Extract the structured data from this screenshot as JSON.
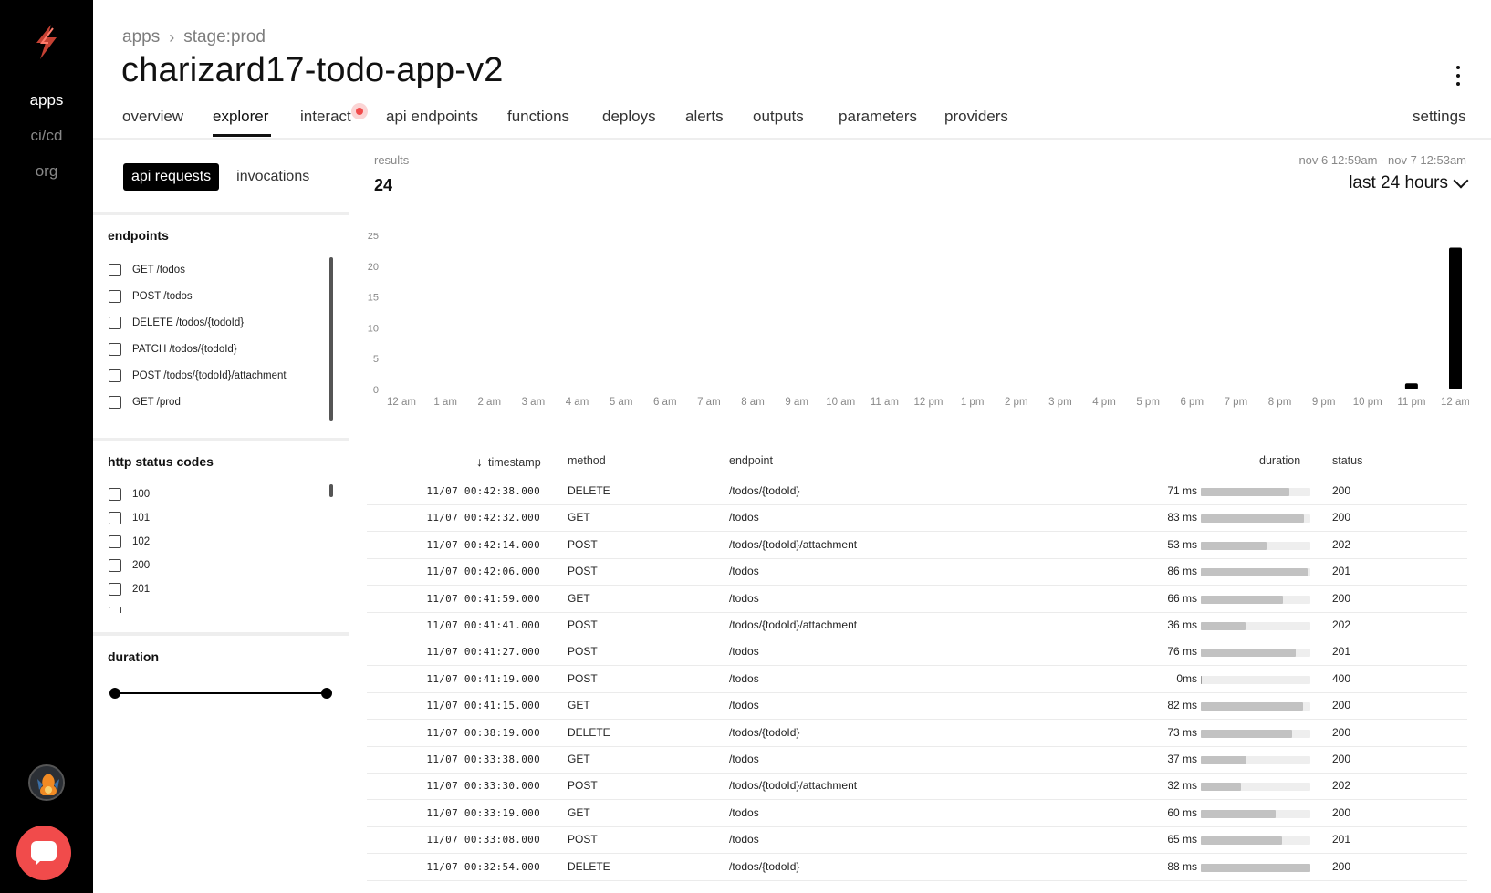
{
  "rail": {
    "items": [
      {
        "label": "apps",
        "active": true
      },
      {
        "label": "ci/cd",
        "active": false
      },
      {
        "label": "org",
        "active": false
      }
    ],
    "logo_color": "#e74c3c",
    "chat_color": "#f14b4b"
  },
  "header": {
    "breadcrumb": [
      "apps",
      "stage:prod"
    ],
    "title": "charizard17-todo-app-v2"
  },
  "tabs": [
    {
      "label": "overview"
    },
    {
      "label": "explorer",
      "active": true
    },
    {
      "label": "interact",
      "badge": true
    },
    {
      "label": "api endpoints"
    },
    {
      "label": "functions"
    },
    {
      "label": "deploys"
    },
    {
      "label": "alerts"
    },
    {
      "label": "outputs"
    },
    {
      "label": "parameters"
    },
    {
      "label": "providers"
    },
    {
      "label": "settings"
    }
  ],
  "filters": {
    "segments": [
      "api requests",
      "invocations"
    ],
    "active_segment": "api requests",
    "endpoints_title": "endpoints",
    "endpoints": [
      "GET /todos",
      "POST /todos",
      "DELETE /todos/{todoId}",
      "PATCH /todos/{todoId}",
      "POST /todos/{todoId}/attachment",
      "GET /prod"
    ],
    "status_title": "http status codes",
    "status_codes": [
      "100",
      "101",
      "102",
      "200",
      "201"
    ],
    "duration_title": "duration"
  },
  "results": {
    "label": "results",
    "count": "24",
    "range_text": "nov 6 12:59am - nov 7 12:53am",
    "range_select": "last 24 hours"
  },
  "chart_data": {
    "type": "bar",
    "categories": [
      "12 am",
      "1 am",
      "2 am",
      "3 am",
      "4 am",
      "5 am",
      "6 am",
      "7 am",
      "8 am",
      "9 am",
      "10 am",
      "11 am",
      "12 pm",
      "1 pm",
      "2 pm",
      "3 pm",
      "4 pm",
      "5 pm",
      "6 pm",
      "7 pm",
      "8 pm",
      "9 pm",
      "10 pm",
      "11 pm",
      "12 am"
    ],
    "values": [
      0,
      0,
      0,
      0,
      0,
      0,
      0,
      0,
      0,
      0,
      0,
      0,
      0,
      0,
      0,
      0,
      0,
      0,
      0,
      0,
      0,
      0,
      0,
      1,
      23
    ],
    "yticks": [
      "0",
      "5",
      "10",
      "15",
      "20",
      "25"
    ],
    "ylim": [
      0,
      25
    ],
    "bar_color": "#000000"
  },
  "table": {
    "headers": {
      "timestamp": "timestamp",
      "method": "method",
      "endpoint": "endpoint",
      "duration": "duration",
      "status": "status"
    },
    "rows": [
      {
        "timestamp": "11/07 00:42:38.000",
        "method": "DELETE",
        "endpoint": "/todos/{todoId}",
        "duration": "71 ms",
        "ms": 71,
        "status": "200"
      },
      {
        "timestamp": "11/07 00:42:32.000",
        "method": "GET",
        "endpoint": "/todos",
        "duration": "83 ms",
        "ms": 83,
        "status": "200"
      },
      {
        "timestamp": "11/07 00:42:14.000",
        "method": "POST",
        "endpoint": "/todos/{todoId}/attachment",
        "duration": "53 ms",
        "ms": 53,
        "status": "202"
      },
      {
        "timestamp": "11/07 00:42:06.000",
        "method": "POST",
        "endpoint": "/todos",
        "duration": "86 ms",
        "ms": 86,
        "status": "201"
      },
      {
        "timestamp": "11/07 00:41:59.000",
        "method": "GET",
        "endpoint": "/todos",
        "duration": "66 ms",
        "ms": 66,
        "status": "200"
      },
      {
        "timestamp": "11/07 00:41:41.000",
        "method": "POST",
        "endpoint": "/todos/{todoId}/attachment",
        "duration": "36 ms",
        "ms": 36,
        "status": "202"
      },
      {
        "timestamp": "11/07 00:41:27.000",
        "method": "POST",
        "endpoint": "/todos",
        "duration": "76 ms",
        "ms": 76,
        "status": "201"
      },
      {
        "timestamp": "11/07 00:41:19.000",
        "method": "POST",
        "endpoint": "/todos",
        "duration": "0ms",
        "ms": 0,
        "status": "400"
      },
      {
        "timestamp": "11/07 00:41:15.000",
        "method": "GET",
        "endpoint": "/todos",
        "duration": "82 ms",
        "ms": 82,
        "status": "200"
      },
      {
        "timestamp": "11/07 00:38:19.000",
        "method": "DELETE",
        "endpoint": "/todos/{todoId}",
        "duration": "73 ms",
        "ms": 73,
        "status": "200"
      },
      {
        "timestamp": "11/07 00:33:38.000",
        "method": "GET",
        "endpoint": "/todos",
        "duration": "37 ms",
        "ms": 37,
        "status": "200"
      },
      {
        "timestamp": "11/07 00:33:30.000",
        "method": "POST",
        "endpoint": "/todos/{todoId}/attachment",
        "duration": "32 ms",
        "ms": 32,
        "status": "202"
      },
      {
        "timestamp": "11/07 00:33:19.000",
        "method": "GET",
        "endpoint": "/todos",
        "duration": "60 ms",
        "ms": 60,
        "status": "200"
      },
      {
        "timestamp": "11/07 00:33:08.000",
        "method": "POST",
        "endpoint": "/todos",
        "duration": "65 ms",
        "ms": 65,
        "status": "201"
      },
      {
        "timestamp": "11/07 00:32:54.000",
        "method": "DELETE",
        "endpoint": "/todos/{todoId}",
        "duration": "88 ms",
        "ms": 88,
        "status": "200"
      }
    ],
    "duration_scale_max": 88
  }
}
